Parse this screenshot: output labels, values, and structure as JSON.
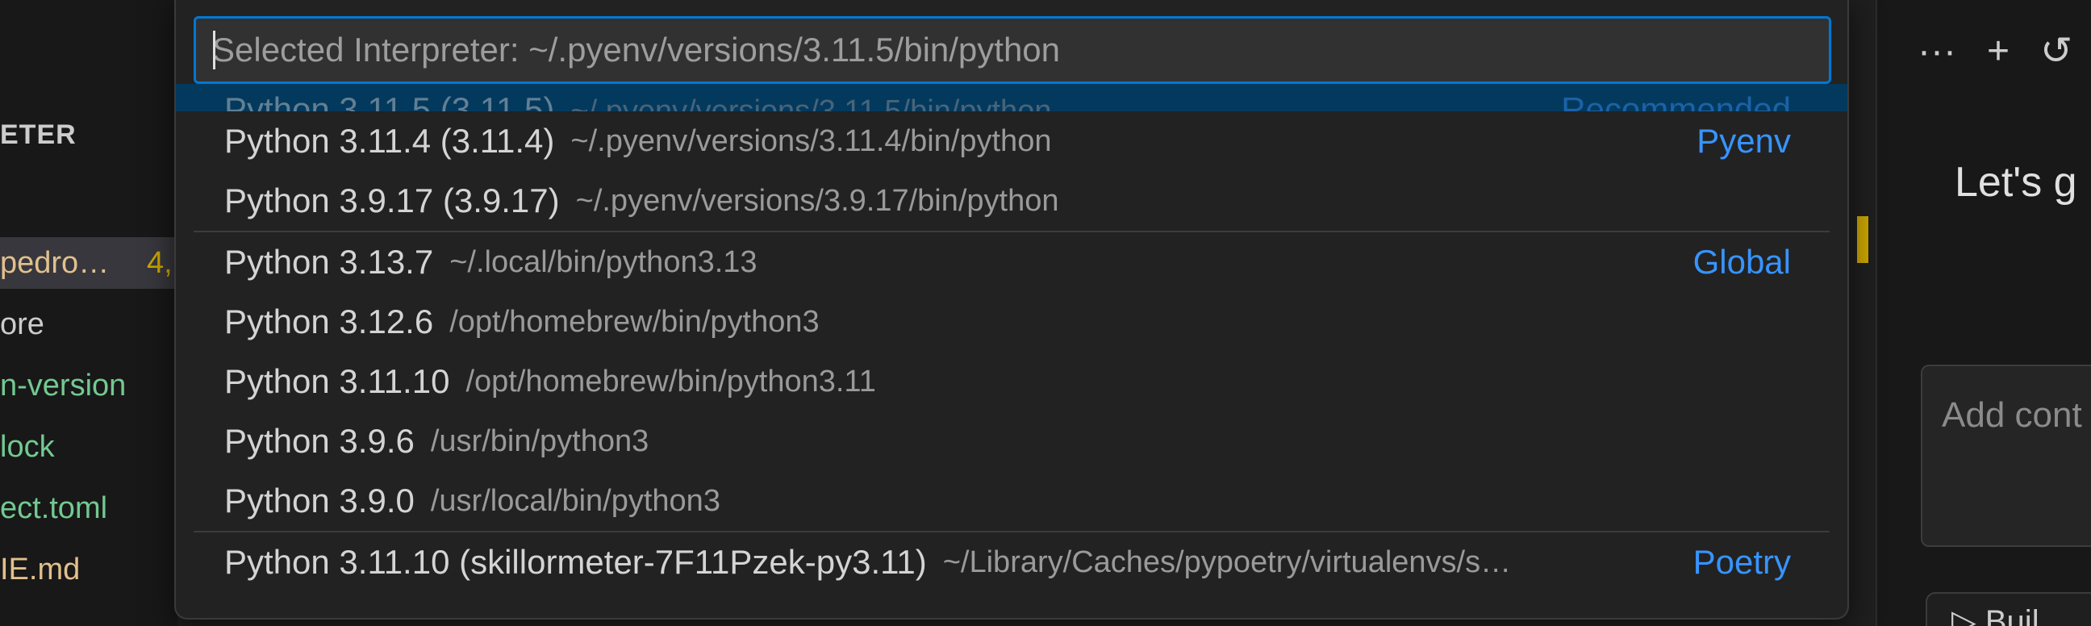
{
  "explorer": {
    "header": "ETER",
    "files": [
      {
        "label": "pedro…",
        "badge": "4,",
        "color": "#e2c08d",
        "selected": true
      },
      {
        "label": "ore",
        "color": "#cccccc"
      },
      {
        "label": "n-version",
        "color": "#73c991"
      },
      {
        "label": "lock",
        "color": "#73c991"
      },
      {
        "label": "ect.toml",
        "color": "#73c991"
      },
      {
        "label": "IE.md",
        "color": "#e2c08d"
      }
    ]
  },
  "chat": {
    "toolbar": {
      "more_icon": "···",
      "add_icon": "+",
      "history_icon": "↺"
    },
    "greeting": "Let's g",
    "input_placeholder": "Add cont",
    "build_label": "▷ Buil"
  },
  "quick_pick": {
    "input_value": "",
    "input_placeholder": "Selected Interpreter: ~/.pyenv/versions/3.11.5/bin/python",
    "partial_row": {
      "label": "Python 3.11.5 (3.11.5)",
      "desc": "~/.pyenv/versions/3.11.5/bin/python",
      "tag": "Recommended"
    },
    "groups": [
      {
        "tag": "Pyenv",
        "items": [
          {
            "label": "Python 3.11.4 (3.11.4)",
            "desc": "~/.pyenv/versions/3.11.4/bin/python"
          },
          {
            "label": "Python 3.9.17 (3.9.17)",
            "desc": "~/.pyenv/versions/3.9.17/bin/python"
          }
        ]
      },
      {
        "tag": "Global",
        "items": [
          {
            "label": "Python 3.13.7",
            "desc": "~/.local/bin/python3.13"
          },
          {
            "label": "Python 3.12.6",
            "desc": "/opt/homebrew/bin/python3"
          },
          {
            "label": "Python 3.11.10",
            "desc": "/opt/homebrew/bin/python3.11"
          },
          {
            "label": "Python 3.9.6",
            "desc": "/usr/bin/python3"
          },
          {
            "label": "Python 3.9.0",
            "desc": "/usr/local/bin/python3"
          }
        ]
      },
      {
        "tag": "Poetry",
        "items": [
          {
            "label": "Python 3.11.10 (skillormeter-7F11Pzek-py3.11)",
            "desc": "~/Library/Caches/pypoetry/virtualenvs/s…"
          }
        ]
      }
    ]
  }
}
